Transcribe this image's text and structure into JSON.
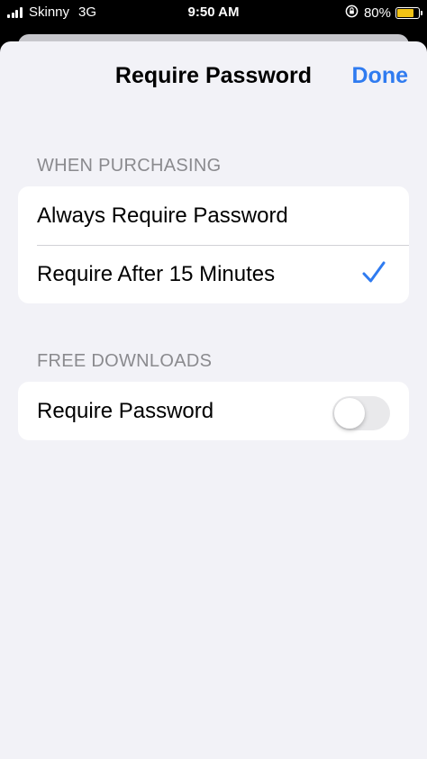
{
  "status_bar": {
    "carrier": "Skinny",
    "network": "3G",
    "time": "9:50 AM",
    "battery_percent": "80%",
    "battery_level": 0.8,
    "battery_color": "#f2c314",
    "icons": [
      "signal-icon",
      "rotation-lock-icon",
      "battery-icon"
    ]
  },
  "nav": {
    "title": "Require Password",
    "done_label": "Done",
    "accent_color": "#2f7bf0"
  },
  "sections": [
    {
      "header": "WHEN PURCHASING",
      "rows": [
        {
          "label": "Always Require Password",
          "selected": false
        },
        {
          "label": "Require After 15 Minutes",
          "selected": true
        }
      ]
    },
    {
      "header": "FREE DOWNLOADS",
      "rows": [
        {
          "label": "Require Password",
          "toggle": false
        }
      ]
    }
  ]
}
